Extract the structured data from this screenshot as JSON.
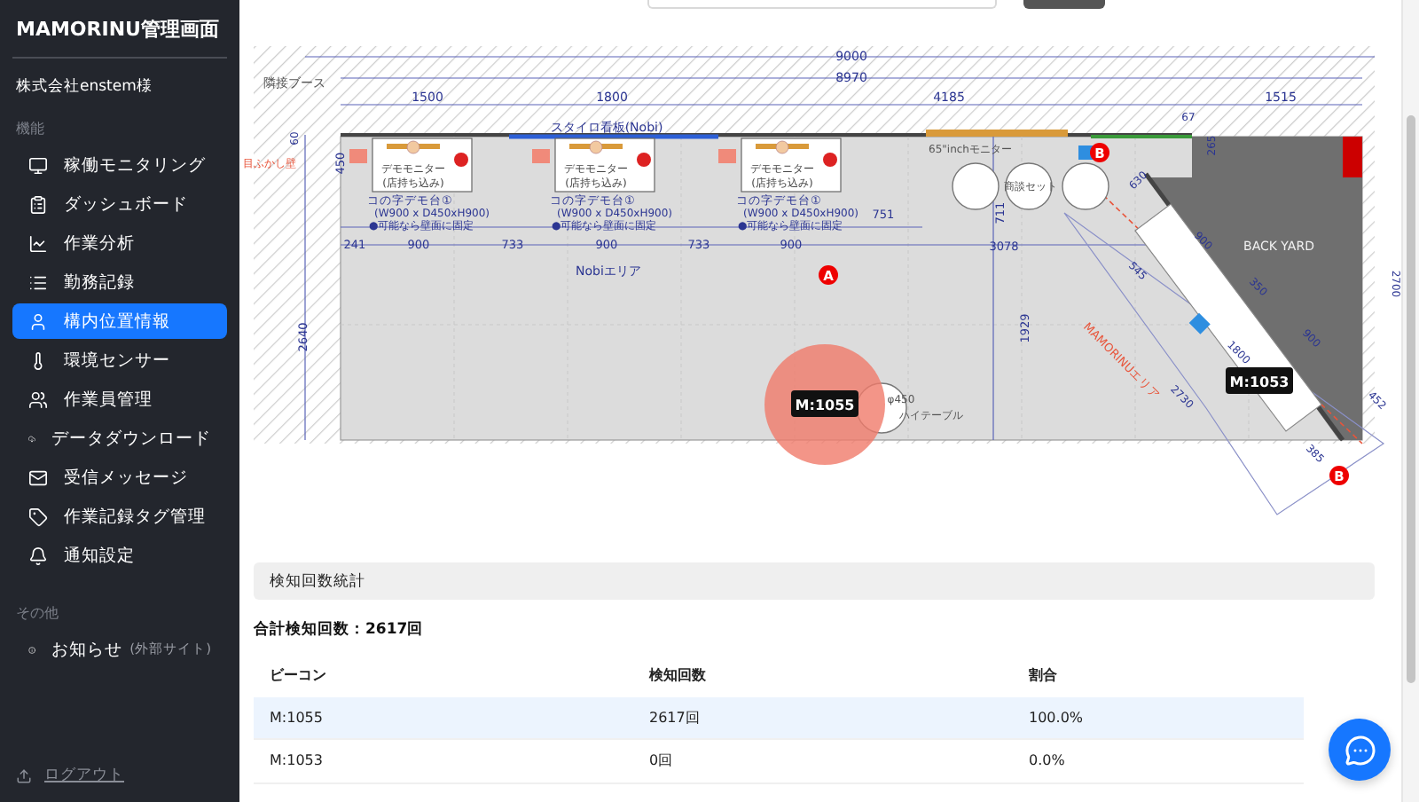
{
  "sidebar": {
    "title": "MAMORINU管理画面",
    "account": "株式会社enstem様",
    "sections": [
      {
        "heading": "機能",
        "items": [
          {
            "label": "稼働モニタリング",
            "selected": false
          },
          {
            "label": "ダッシュボード",
            "selected": false
          },
          {
            "label": "作業分析",
            "selected": false
          },
          {
            "label": "勤務記録",
            "selected": false
          },
          {
            "label": "構内位置情報",
            "selected": true
          },
          {
            "label": "環境センサー",
            "selected": false
          },
          {
            "label": "作業員管理",
            "selected": false
          },
          {
            "label": "データダウンロード",
            "selected": false
          },
          {
            "label": "受信メッセージ",
            "selected": false
          },
          {
            "label": "作業記録タグ管理",
            "selected": false
          },
          {
            "label": "通知設定",
            "selected": false
          }
        ]
      },
      {
        "heading": "その他",
        "items": [
          {
            "label": "お知らせ",
            "note": "(外部サイト)",
            "selected": false
          }
        ]
      }
    ],
    "logout": "ログアウト"
  },
  "floor_plan": {
    "labels": [
      {
        "text": "9000",
        "kind": "dimension"
      },
      {
        "text": "8970",
        "kind": "dimension"
      },
      {
        "text": "隣接ブース",
        "kind": "note"
      },
      {
        "text": "1500",
        "kind": "dimension"
      },
      {
        "text": "1800",
        "kind": "dimension"
      },
      {
        "text": "4185",
        "kind": "dimension"
      },
      {
        "text": "1515",
        "kind": "dimension"
      },
      {
        "text": "スタイロ看板(Nobi)",
        "kind": "dimension"
      },
      {
        "text": "67",
        "kind": "dimension"
      },
      {
        "text": "60",
        "kind": "dimension"
      },
      {
        "text": "目ふかし壁",
        "kind": "accent"
      },
      {
        "text": "450",
        "kind": "dimension"
      },
      {
        "text": "241",
        "kind": "dimension"
      },
      {
        "text": "900",
        "kind": "dimension"
      },
      {
        "text": "733",
        "kind": "dimension"
      },
      {
        "text": "900",
        "kind": "dimension"
      },
      {
        "text": "733",
        "kind": "dimension"
      },
      {
        "text": "900",
        "kind": "dimension"
      },
      {
        "text": "751",
        "kind": "dimension"
      },
      {
        "text": "3078",
        "kind": "dimension"
      },
      {
        "text": "Nobiエリア",
        "kind": "dimension"
      },
      {
        "text": "2640",
        "kind": "dimension"
      },
      {
        "text": "1929",
        "kind": "dimension"
      },
      {
        "text": "711",
        "kind": "dimension"
      },
      {
        "text": "65\"inchモニター",
        "kind": "note"
      },
      {
        "text": "商談セット",
        "kind": "note"
      },
      {
        "text": "265",
        "kind": "dimension"
      },
      {
        "text": "630",
        "kind": "dimension"
      },
      {
        "text": "BACK YARD",
        "kind": "note"
      },
      {
        "text": "900",
        "kind": "dimension"
      },
      {
        "text": "350",
        "kind": "dimension"
      },
      {
        "text": "900",
        "kind": "dimension"
      },
      {
        "text": "2700",
        "kind": "dimension"
      },
      {
        "text": "452",
        "kind": "dimension"
      },
      {
        "text": "385",
        "kind": "dimension"
      },
      {
        "text": "2730",
        "kind": "dimension"
      },
      {
        "text": "MAMORINUエリア",
        "kind": "accent"
      },
      {
        "text": "545",
        "kind": "dimension"
      },
      {
        "text": "1800",
        "kind": "dimension"
      },
      {
        "text": "φ450",
        "kind": "note"
      },
      {
        "text": "ハイテーブル",
        "kind": "note"
      }
    ],
    "desks": [
      {
        "monitor": "デモモニター",
        "monitor_note": "(店持ち込み)",
        "title": "コの字デモ台①",
        "size": "(W900 x D450xH900)",
        "note": "●可能なら壁面に固定"
      },
      {
        "monitor": "デモモニター",
        "monitor_note": "(店持ち込み)",
        "title": "コの字デモ台①",
        "size": "(W900 x D450xH900)",
        "note": "●可能なら壁面に固定"
      },
      {
        "monitor": "デモモニター",
        "monitor_note": "(店持ち込み)",
        "title": "コの字デモ台①",
        "size": "(W900 x D450xH900)",
        "note": "●可能なら壁面に固定"
      }
    ],
    "markers": [
      "A",
      "B",
      "B"
    ],
    "beacons": [
      {
        "label": "M:1055",
        "detected": true
      },
      {
        "label": "M:1053",
        "detected": false
      }
    ]
  },
  "stats": {
    "title": "検知回数統計",
    "total": "合計検知回数：2617回",
    "columns": [
      "ビーコン",
      "検知回数",
      "割合"
    ],
    "rows": [
      {
        "cells": [
          "M:1055",
          "2617回",
          "100.0%"
        ],
        "selected": true
      },
      {
        "cells": [
          "M:1053",
          "0回",
          "0.0%"
        ],
        "selected": false
      }
    ]
  }
}
